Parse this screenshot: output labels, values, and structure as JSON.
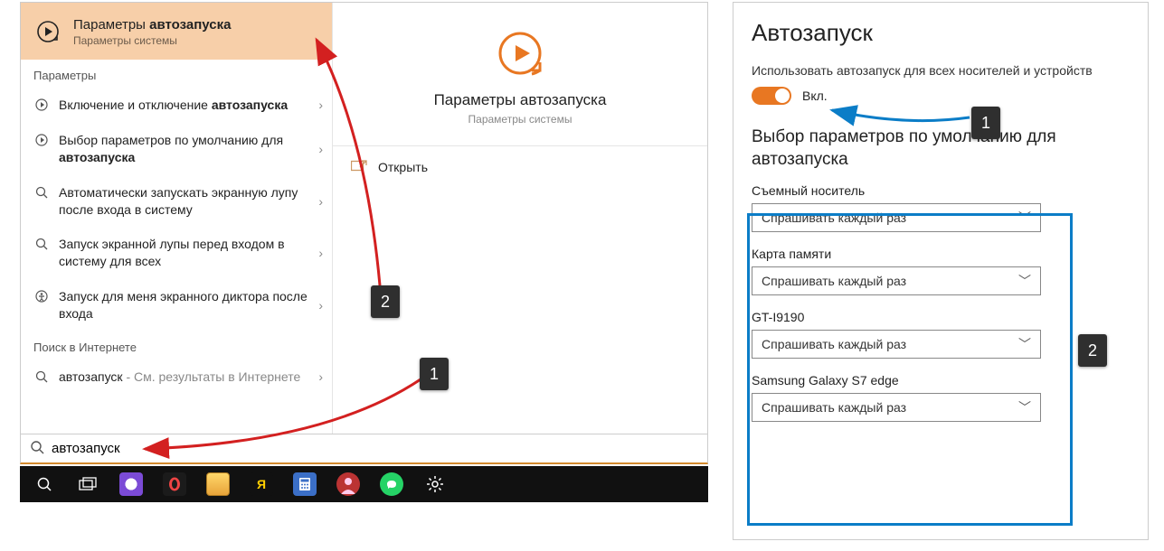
{
  "search": {
    "best_hit": {
      "title_plain": "Параметры ",
      "title_bold": "автозапуска",
      "subtitle": "Параметры системы"
    },
    "section_params": "Параметры",
    "results": [
      {
        "before": "Включение и отключение ",
        "bold": "автозапуска",
        "after": ""
      },
      {
        "before": "Выбор параметров по умолчанию для ",
        "bold": "автозапуска",
        "after": ""
      },
      {
        "before": "Автоматически запускать экранную лупу после входа в систему",
        "bold": "",
        "after": ""
      },
      {
        "before": "Запуск экранной лупы перед входом в систему для всех",
        "bold": "",
        "after": ""
      },
      {
        "before": "Запуск для меня экранного диктора после входа",
        "bold": "",
        "after": ""
      }
    ],
    "section_web": "Поиск в Интернете",
    "web_result": {
      "term": "автозапуск",
      "tail": " - См. результаты в Интернете"
    },
    "query": "автозапуск",
    "detail": {
      "title": "Параметры автозапуска",
      "subtitle": "Параметры системы",
      "open": "Открыть"
    }
  },
  "settings": {
    "heading": "Автозапуск",
    "note": "Использовать автозапуск для всех носителей и устройств",
    "toggle_state": "Вкл.",
    "sub_heading": "Выбор параметров по умолчанию для автозапуска",
    "devices": [
      {
        "label": "Съемный носитель",
        "value": "Спрашивать каждый раз"
      },
      {
        "label": "Карта памяти",
        "value": "Спрашивать каждый раз"
      },
      {
        "label": "GT-I9190",
        "value": "Спрашивать каждый раз"
      },
      {
        "label": "Samsung Galaxy S7 edge",
        "value": "Спрашивать каждый раз"
      }
    ]
  },
  "taskbar": {
    "icons": [
      "search",
      "task-view",
      "yandex-circle",
      "opera",
      "explorer",
      "yandex",
      "calculator",
      "opera-red",
      "whatsapp",
      "settings-gear"
    ]
  },
  "annotations": {
    "left1": "1",
    "left2": "2",
    "right1": "1",
    "right2": "2"
  },
  "colors": {
    "accent_orange": "#e87722",
    "highlight_bg": "#f7cfa9",
    "frame_blue": "#0b7dc7",
    "arrow_red": "#d32020",
    "arrow_blue": "#0b7dc7"
  }
}
